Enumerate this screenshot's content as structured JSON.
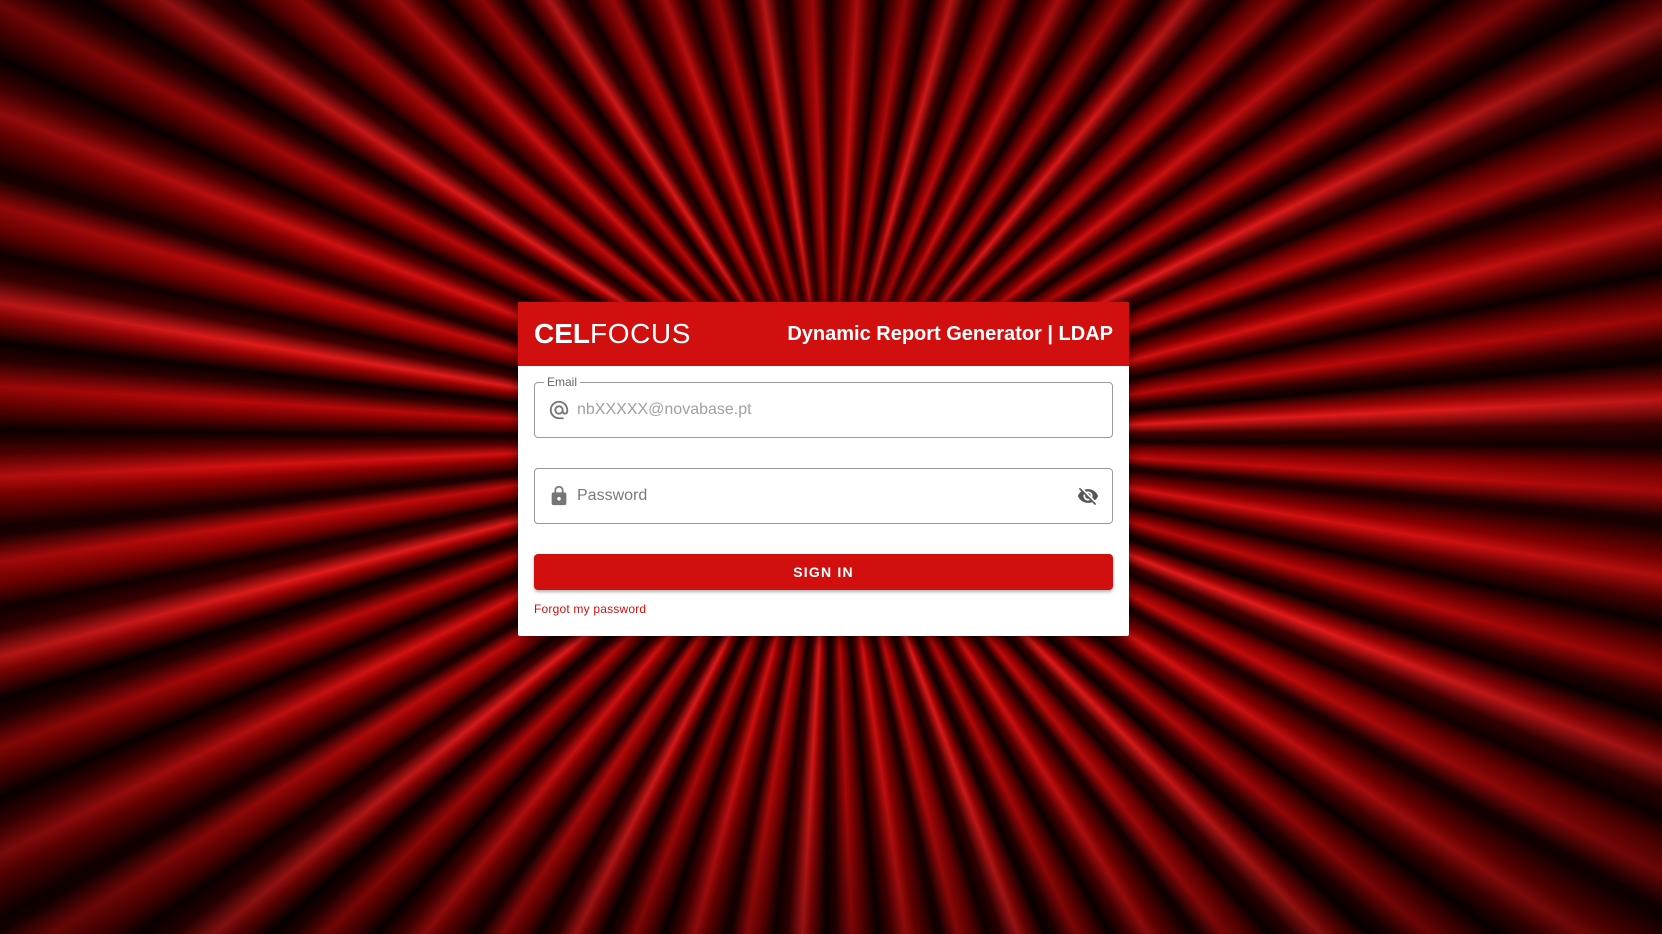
{
  "header": {
    "logo_bold": "CEL",
    "logo_light": "FOCUS",
    "app_title": "Dynamic Report Generator | LDAP"
  },
  "email": {
    "label": "Email",
    "placeholder": "nbXXXXX@novabase.pt",
    "value": "",
    "icon": "at-sign-icon"
  },
  "password": {
    "placeholder": "Password",
    "value": "",
    "icon": "lock-icon",
    "toggle_icon": "eye-off-icon"
  },
  "actions": {
    "sign_in_label": "SIGN IN",
    "forgot_label": "Forgot my password"
  },
  "colors": {
    "brand": "#d20f0f",
    "card_bg": "#ffffff"
  }
}
